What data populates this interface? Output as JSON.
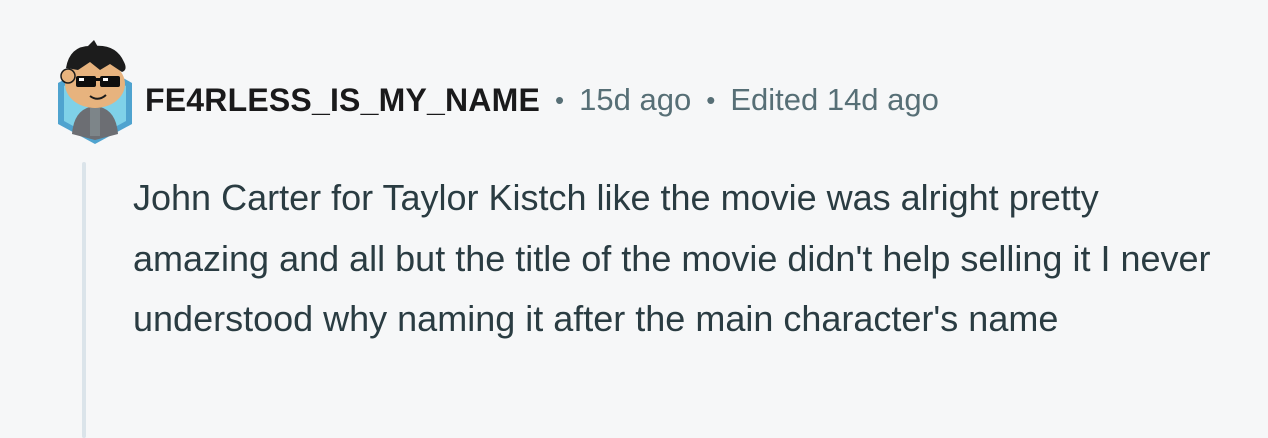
{
  "comment": {
    "username": "FE4RLESS_IS_MY_NAME",
    "separator": "•",
    "time_ago": "15d ago",
    "edited": "Edited 14d ago",
    "body": "John Carter for Taylor Kistch like the movie was alright pretty amazing and all but the title of the movie didn't help selling it I never understood why naming it after the main character's name"
  },
  "colors": {
    "background": "#f6f7f8",
    "username": "#1a1a1b",
    "meta": "#576f76",
    "body": "#2a3c42",
    "thread_line": "#dbe4ea",
    "avatar_frame": "#5aa7d1"
  },
  "icons": {
    "avatar": "snoo-avatar-with-sunglasses"
  }
}
